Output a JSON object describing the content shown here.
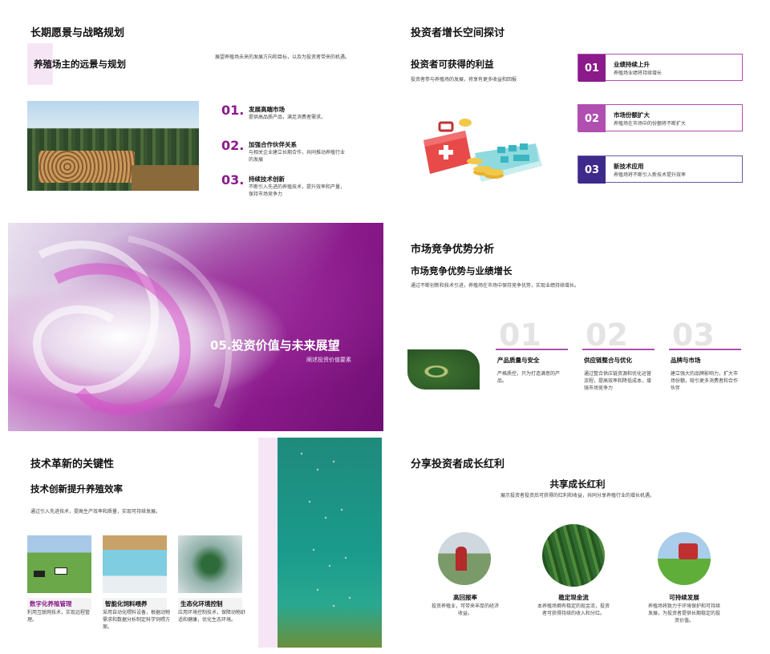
{
  "slide1": {
    "title": "长期愿景与战略规划",
    "subtitle": "养殖场主的远景与规划",
    "desc": "展望养殖场未来的发展方向和目标，以及为投资者带来的机遇。",
    "items": [
      {
        "num": "01.",
        "head": "发展高端市场",
        "body": "提供高品质产品，满足消费者需求。"
      },
      {
        "num": "02.",
        "head": "加强合作伙伴关系",
        "body": "与相关企业建立长期合作，共同推动养殖行业的发展"
      },
      {
        "num": "03.",
        "head": "持续技术创新",
        "body": "不断引入先进的养殖技术，提升效率和产量，保持市场竞争力"
      }
    ]
  },
  "slide2": {
    "title": "投资者增长空间探讨",
    "subtitle": "投资者可获得的利益",
    "desc": "投资者参与养殖场的发展，将享有更多收益和回报",
    "cards": [
      {
        "num": "01",
        "head": "业绩持续上升",
        "body": "养殖场业绩将持续增长",
        "color": "#8b1a8b"
      },
      {
        "num": "02",
        "head": "市场份额扩大",
        "body": "养殖场在市场中的份额将不断扩大",
        "color": "#b04fb0"
      },
      {
        "num": "03",
        "head": "新技术应用",
        "body": "养殖场将不断引入新技术提升效率",
        "color": "#3d2a8a"
      }
    ]
  },
  "slide3": {
    "title": "05.投资价值与未来展望",
    "subtitle": "阐述投资价值要素"
  },
  "slide4": {
    "title": "市场竞争优势分析",
    "subtitle": "市场竞争优势与业绩增长",
    "desc": "通过不断创新和技术引进，养殖场在市场中保持竞争优势，实现业绩持续增长。",
    "items": [
      {
        "num": "01",
        "head": "产品质量与安全",
        "body": "严格质控，只为打造满意的产品。"
      },
      {
        "num": "02",
        "head": "供应链整合与优化",
        "body": "通过整合供应链资源和优化运营流程，提高效率和降低成本，增强市场竞争力"
      },
      {
        "num": "03",
        "head": "品牌与市场",
        "body": "建立强大的品牌影响力，扩大市场份额，吸引更多消费者和合作伙伴"
      }
    ]
  },
  "slide5": {
    "title": "技术革新的关键性",
    "subtitle": "技术创新提升养殖效率",
    "desc": "通过引入先进技术，提高生产效率和质量，实现可持续发展。",
    "items": [
      {
        "head": "数字化养殖管理",
        "body": "利用互联网技术，实现远程管理。"
      },
      {
        "head": "智能化饲料喂养",
        "body": "采用自动化喂料设备，根据动物需求和数据分析制定科学饲喂方案。"
      },
      {
        "head": "生态化环境控制",
        "body": "应用环境控制技术，保障动物舒适和健康，优化生态环境。"
      }
    ]
  },
  "slide6": {
    "title": "分享投资者成长红利",
    "subtitle": "共享成长红利",
    "desc": "展示投资者投资后可获得的红利和收益，共同分享养殖行业的增长机遇。",
    "items": [
      {
        "head": "高回报率",
        "body": "投资养殖业，可带来丰厚的经济收益。"
      },
      {
        "head": "稳定现金流",
        "body": "本养殖场拥有稳定的现金流，投资者可获得持续的收入和分红。"
      },
      {
        "head": "可持续发展",
        "body": "养殖场将致力于环境保护和可持续发展，为投资者提供长期稳定的投资价值。"
      }
    ]
  }
}
